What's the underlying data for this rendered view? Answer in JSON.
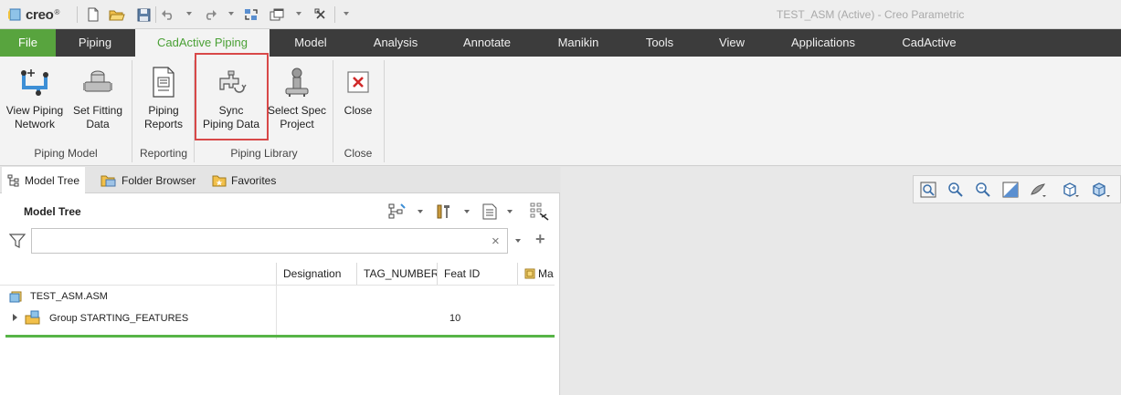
{
  "app": {
    "logo_text": "creo",
    "window_title": "TEST_ASM (Active) - Creo Parametric"
  },
  "quick_access": {
    "icons": [
      "new-file-icon",
      "open-folder-icon",
      "save-icon",
      "undo-icon",
      "redo-icon",
      "regenerate-icon",
      "windows-icon",
      "close-window-icon",
      "customize-icon"
    ]
  },
  "tabs": [
    {
      "label": "File",
      "state": "file"
    },
    {
      "label": "Piping",
      "state": "normal"
    },
    {
      "label": "CadActive Piping",
      "state": "active"
    },
    {
      "label": "Model",
      "state": "normal"
    },
    {
      "label": "Analysis",
      "state": "normal"
    },
    {
      "label": "Annotate",
      "state": "normal"
    },
    {
      "label": "Manikin",
      "state": "normal"
    },
    {
      "label": "Tools",
      "state": "normal"
    },
    {
      "label": "View",
      "state": "normal"
    },
    {
      "label": "Applications",
      "state": "normal"
    },
    {
      "label": "CadActive",
      "state": "normal"
    }
  ],
  "ribbon": {
    "buttons": {
      "view_piping_network": "View Piping\nNetwork",
      "set_fitting_data": "Set Fitting\nData",
      "piping_reports": "Piping\nReports",
      "sync_piping_data": "Sync\nPiping Data",
      "select_spec_project": "Select Spec\nProject",
      "close": "Close"
    },
    "groups": {
      "piping_model": "Piping Model",
      "reporting": "Reporting",
      "piping_library": "Piping Library",
      "close": "Close"
    }
  },
  "left_panel": {
    "tabs": {
      "model_tree": "Model Tree",
      "folder_browser": "Folder Browser",
      "favorites": "Favorites"
    },
    "header": "Model Tree",
    "filter": {
      "value": "",
      "placeholder": ""
    },
    "columns": {
      "designation": "Designation",
      "tag_number": "TAG_NUMBER",
      "feat_id": "Feat ID",
      "material": "Ma"
    },
    "rows": [
      {
        "name": "TEST_ASM.ASM",
        "feat_id": ""
      },
      {
        "name": "Group STARTING_FEATURES",
        "feat_id": "10"
      }
    ]
  },
  "view_toolbar": {
    "icons": [
      "refit-icon",
      "zoom-in-icon",
      "zoom-out-icon",
      "repaint-icon",
      "display-style-icon",
      "saved-orientations-icon",
      "view-manager-icon"
    ]
  },
  "colors": {
    "accent_green": "#58a43e",
    "tab_bar": "#3c3c3c",
    "highlight_red": "#d84848"
  }
}
